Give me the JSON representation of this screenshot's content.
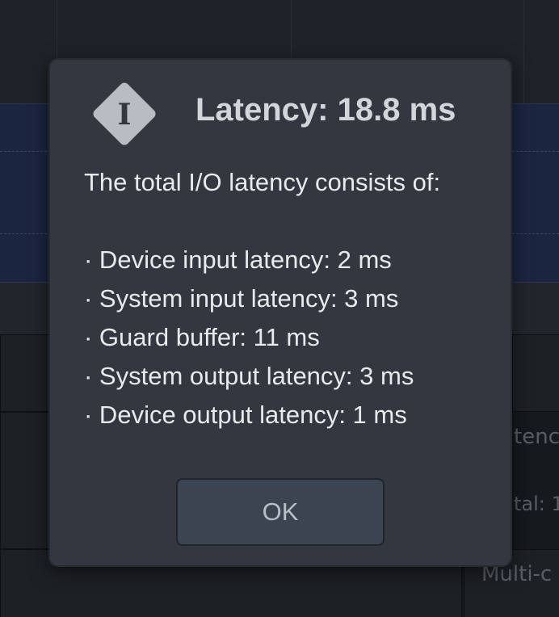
{
  "dialog": {
    "icon": "info-icon",
    "title": "Latency: 18.8 ms",
    "intro": "The total I/O latency consists of:",
    "items": [
      "· Device input latency: 2 ms",
      "· System input latency: 3 ms",
      "· Guard buffer: 11 ms",
      "· System output latency: 3 ms",
      "· Device output latency: 1 ms"
    ],
    "ok_label": "OK"
  },
  "background": {
    "peek_right_1": "tenc",
    "peek_right_2": "tal: 1",
    "peek_right_3": "Multi-c"
  },
  "colors": {
    "dialog_bg": "#323740",
    "title": "#d2d5da",
    "text": "#e8eaed",
    "button_bg": "#3b4450",
    "track_bg": "#1c2540"
  }
}
